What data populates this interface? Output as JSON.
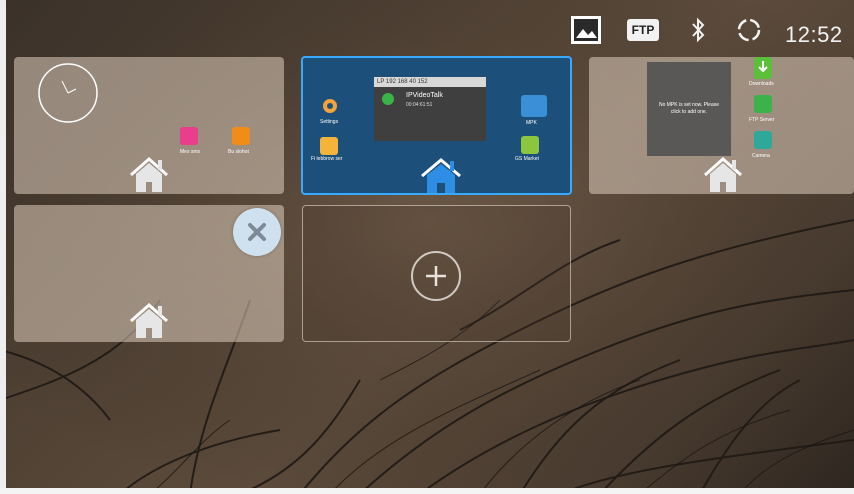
{
  "status_bar": {
    "icons": [
      "picture-icon",
      "ftp-icon",
      "bluetooth-icon",
      "sync-icon"
    ],
    "ftp_label": "FTP",
    "time": "12:52"
  },
  "screens": {
    "screen1": {
      "apps": [
        {
          "label": "Mes sms",
          "icon": "phone-icon",
          "color": "#e83e8c"
        },
        {
          "label": "Bu slohot",
          "icon": "call-icon",
          "color": "#f08c18"
        }
      ]
    },
    "screen2": {
      "widget_header": "LP 192 168 40 152",
      "widget_title": "IPVideoTalk",
      "widget_sub": "00:04:61:51",
      "apps": [
        {
          "label": "Settings",
          "icon": "gear-icon"
        },
        {
          "label": "Fi lebbrow ser",
          "icon": "folder-icon"
        },
        {
          "label": "MPK",
          "icon": "mpk-icon"
        },
        {
          "label": "GS Market",
          "icon": "android-icon"
        }
      ],
      "mpk_tile": "MPK"
    },
    "screen3": {
      "mpk_text": "No MPK is set now. Please\nclick to add one.",
      "apps": [
        {
          "label": "Downloads",
          "icon": "download-icon"
        },
        {
          "label": "FTP Server",
          "icon": "ftp-icon"
        },
        {
          "label": "Camera",
          "icon": "camera-icon"
        }
      ]
    }
  },
  "colors": {
    "active_border": "#39a8ff",
    "active_bg": "#1c4f79",
    "home_blue": "#2e8ee6"
  }
}
